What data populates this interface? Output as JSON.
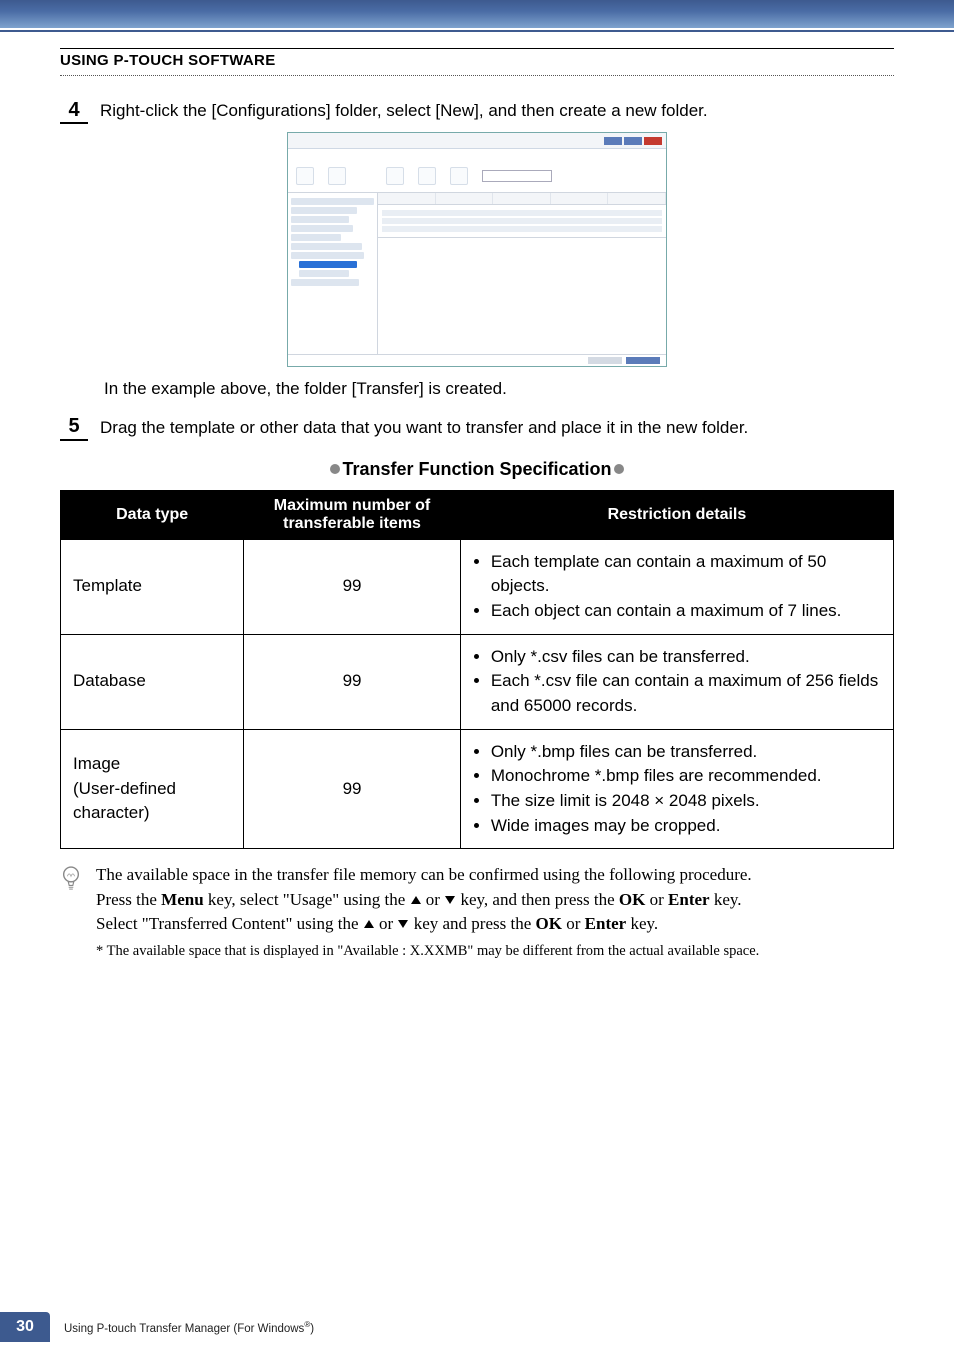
{
  "section_header": "USING P-TOUCH SOFTWARE",
  "steps": {
    "s4": {
      "num": "4",
      "text": "Right-click the [Configurations] folder, select [New], and then create a new folder."
    },
    "s4_caption": "In the example above, the folder [Transfer] is created.",
    "s5": {
      "num": "5",
      "text": "Drag the template or other data that you want to transfer and place it in the new folder."
    }
  },
  "tfs_title": "Transfer Function Specification",
  "table": {
    "headers": {
      "c1": "Data type",
      "c2": "Maximum number of transferable items",
      "c3": "Restriction details"
    },
    "rows": [
      {
        "type": "Template",
        "max": "99",
        "details": [
          "Each template can contain a maximum of 50 objects.",
          "Each object can contain a maximum of 7 lines."
        ]
      },
      {
        "type": "Database",
        "max": "99",
        "details": [
          "Only *.csv files can be transferred.",
          "Each *.csv file can contain a maximum of 256 fields and 65000 records."
        ]
      },
      {
        "type": "Image\n(User-defined character)",
        "max": "99",
        "details": [
          "Only *.bmp files can be transferred.",
          "Monochrome *.bmp files are recommended.",
          "The size limit is 2048 × 2048 pixels.",
          "Wide images may be cropped."
        ]
      }
    ]
  },
  "note": {
    "line1_a": "The available space in the transfer file memory can be confirmed using the following procedure.",
    "line2_a": "Press the ",
    "menu_bold": "Menu",
    "line2_b": " key, select \"Usage\" using the ",
    "line2_c": " or ",
    "line2_d": " key, and then press the ",
    "ok_bold": "OK",
    "line2_e": " or ",
    "enter_bold": "Enter",
    "line2_f": " key.",
    "line3_a": "Select \"Transferred Content\" using the ",
    "line3_b": " or ",
    "line3_c": " key and press the ",
    "line3_d": " or ",
    "line3_e": " key.",
    "footnote": "* The available space that is displayed in \"Available : X.XXMB\" may be different from the actual available space."
  },
  "footer": {
    "page": "30",
    "label_a": "Using P-touch Transfer Manager (For Windows",
    "label_sup": "®",
    "label_b": ")"
  }
}
